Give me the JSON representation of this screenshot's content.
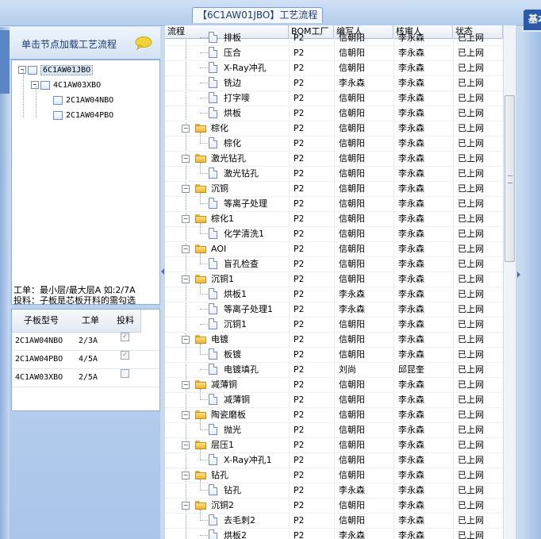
{
  "title_tab": "【6C1AW01JBO】工艺流程",
  "right_tab": "基本",
  "left": {
    "header": "单击节点加载工艺流程",
    "tree": [
      {
        "label": "6C1AW01JBO",
        "level": 0,
        "expand": "-",
        "selected": true
      },
      {
        "label": "4C1AW03XBO",
        "level": 1,
        "expand": "-",
        "selected": false
      },
      {
        "label": "2C1AW04NBO",
        "level": 2,
        "expand": "",
        "selected": false
      },
      {
        "label": "2C1AW04PBO",
        "level": 2,
        "expand": "",
        "selected": false
      }
    ],
    "info_line1": "工单：最小层/最大层A 如:2/7A",
    "info_line2": "投料：子板是芯板开料的需勾选",
    "table": {
      "headers": [
        "子板型号",
        "工单",
        "投料"
      ],
      "rows": [
        {
          "model": "2C1AW04NBO",
          "order": "2/3A",
          "feed": true
        },
        {
          "model": "2C1AW04PBO",
          "order": "4/5A",
          "feed": true
        },
        {
          "model": "4C1AW03XBO",
          "order": "2/5A",
          "feed": false
        }
      ]
    }
  },
  "grid": {
    "headers": [
      "流程",
      "BOM工厂",
      "编写人",
      "核审人",
      "状态"
    ],
    "rows": [
      {
        "name": "排板",
        "type": "doc",
        "factory": "P2",
        "writer": "信朝阳",
        "checker": "李永森",
        "status": "已上网"
      },
      {
        "name": "压合",
        "type": "doc",
        "factory": "P2",
        "writer": "信朝阳",
        "checker": "李永森",
        "status": "已上网"
      },
      {
        "name": "X-Ray冲孔",
        "type": "doc",
        "factory": "P2",
        "writer": "信朝阳",
        "checker": "李永森",
        "status": "已上网"
      },
      {
        "name": "铣边",
        "type": "doc",
        "factory": "P2",
        "writer": "李永森",
        "checker": "李永森",
        "status": "已上网"
      },
      {
        "name": "打字嘜",
        "type": "doc",
        "factory": "P2",
        "writer": "信朝阳",
        "checker": "李永森",
        "status": "已上网"
      },
      {
        "name": "烘板",
        "type": "doc",
        "factory": "P2",
        "writer": "信朝阳",
        "checker": "李永森",
        "status": "已上网"
      },
      {
        "name": "棕化",
        "type": "folder",
        "factory": "P2",
        "writer": "信朝阳",
        "checker": "李永森",
        "status": "已上网"
      },
      {
        "name": "棕化",
        "type": "doc",
        "factory": "P2",
        "writer": "信朝阳",
        "checker": "李永森",
        "status": "已上网"
      },
      {
        "name": "激光钻孔",
        "type": "folder",
        "factory": "P2",
        "writer": "信朝阳",
        "checker": "李永森",
        "status": "已上网"
      },
      {
        "name": "激光钻孔",
        "type": "doc",
        "factory": "P2",
        "writer": "信朝阳",
        "checker": "李永森",
        "status": "已上网"
      },
      {
        "name": "沉铜",
        "type": "folder",
        "factory": "P2",
        "writer": "信朝阳",
        "checker": "李永森",
        "status": "已上网"
      },
      {
        "name": "等离子处理",
        "type": "doc",
        "factory": "P2",
        "writer": "信朝阳",
        "checker": "李永森",
        "status": "已上网"
      },
      {
        "name": "棕化1",
        "type": "folder",
        "factory": "P2",
        "writer": "信朝阳",
        "checker": "李永森",
        "status": "已上网"
      },
      {
        "name": "化学清洗1",
        "type": "doc",
        "factory": "P2",
        "writer": "信朝阳",
        "checker": "李永森",
        "status": "已上网"
      },
      {
        "name": "AOI",
        "type": "folder",
        "factory": "P2",
        "writer": "信朝阳",
        "checker": "李永森",
        "status": "已上网"
      },
      {
        "name": "盲孔检查",
        "type": "doc",
        "factory": "P2",
        "writer": "信朝阳",
        "checker": "李永森",
        "status": "已上网"
      },
      {
        "name": "沉铜1",
        "type": "folder",
        "factory": "P2",
        "writer": "信朝阳",
        "checker": "李永森",
        "status": "已上网"
      },
      {
        "name": "烘板1",
        "type": "doc",
        "factory": "P2",
        "writer": "李永森",
        "checker": "李永森",
        "status": "已上网"
      },
      {
        "name": "等离子处理1",
        "type": "doc",
        "factory": "P2",
        "writer": "李永森",
        "checker": "李永森",
        "status": "已上网"
      },
      {
        "name": "沉铜1",
        "type": "doc",
        "factory": "P2",
        "writer": "信朝阳",
        "checker": "李永森",
        "status": "已上网"
      },
      {
        "name": "电镀",
        "type": "folder",
        "factory": "P2",
        "writer": "信朝阳",
        "checker": "李永森",
        "status": "已上网"
      },
      {
        "name": "板镀",
        "type": "doc",
        "factory": "P2",
        "writer": "信朝阳",
        "checker": "李永森",
        "status": "已上网"
      },
      {
        "name": "电镀填孔",
        "type": "doc",
        "factory": "P2",
        "writer": "刘尚",
        "checker": "邱昆奎",
        "status": "已上网"
      },
      {
        "name": "减薄铜",
        "type": "folder",
        "factory": "P2",
        "writer": "信朝阳",
        "checker": "李永森",
        "status": "已上网"
      },
      {
        "name": "减薄铜",
        "type": "doc",
        "factory": "P2",
        "writer": "信朝阳",
        "checker": "李永森",
        "status": "已上网"
      },
      {
        "name": "陶瓷磨板",
        "type": "folder",
        "factory": "P2",
        "writer": "信朝阳",
        "checker": "李永森",
        "status": "已上网"
      },
      {
        "name": "抛光",
        "type": "doc",
        "factory": "P2",
        "writer": "信朝阳",
        "checker": "李永森",
        "status": "已上网"
      },
      {
        "name": "层压1",
        "type": "folder",
        "factory": "P2",
        "writer": "信朝阳",
        "checker": "李永森",
        "status": "已上网"
      },
      {
        "name": "X-Ray冲孔1",
        "type": "doc",
        "factory": "P2",
        "writer": "信朝阳",
        "checker": "李永森",
        "status": "已上网"
      },
      {
        "name": "钻孔",
        "type": "folder",
        "factory": "P2",
        "writer": "信朝阳",
        "checker": "李永森",
        "status": "已上网"
      },
      {
        "name": "钻孔",
        "type": "doc",
        "factory": "P2",
        "writer": "李永森",
        "checker": "李永森",
        "status": "已上网"
      },
      {
        "name": "沉铜2",
        "type": "folder",
        "factory": "P2",
        "writer": "信朝阳",
        "checker": "李永森",
        "status": "已上网"
      },
      {
        "name": "去毛刺2",
        "type": "doc",
        "factory": "P2",
        "writer": "信朝阳",
        "checker": "李永森",
        "status": "已上网"
      },
      {
        "name": "烘板2",
        "type": "doc",
        "factory": "P2",
        "writer": "李永森",
        "checker": "李永森",
        "status": "已上网"
      }
    ]
  }
}
